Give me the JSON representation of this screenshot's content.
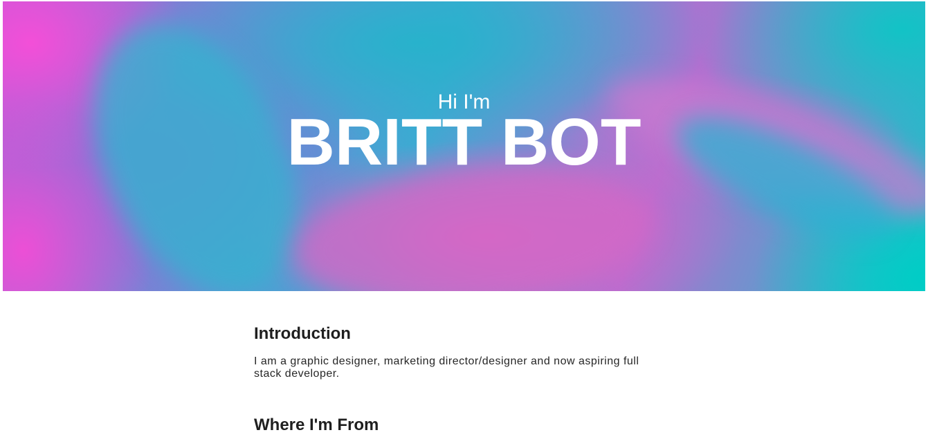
{
  "hero": {
    "greeting": "Hi I'm",
    "name": "BRITT BOT",
    "gradient_colors": [
      "#f34fd8",
      "#28b2cc",
      "#d766c8",
      "#00cdc6"
    ]
  },
  "sections": [
    {
      "title": "Introduction",
      "body": "I am a graphic designer, marketing director/designer and now aspiring full stack developer."
    },
    {
      "title": "Where I'm From"
    }
  ]
}
